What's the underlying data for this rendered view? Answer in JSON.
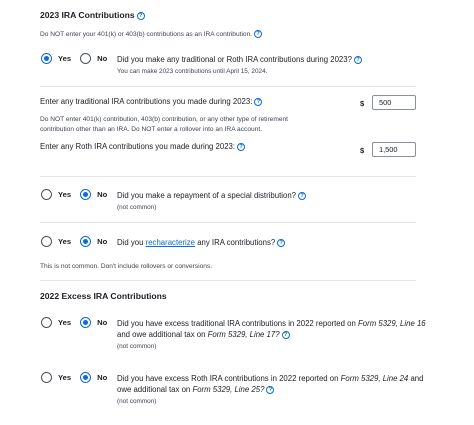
{
  "section1": {
    "heading": "2023 IRA Contributions",
    "note": "Do NOT enter your 401(k) or 403(b) contributions as an IRA contribution.",
    "q1": {
      "yes": "Yes",
      "no": "No",
      "text": "Did you make any traditional or Roth IRA contributions during 2023?",
      "sub": "You can make 2023 contributions until April 15, 2024.",
      "selected": "yes"
    },
    "traditional": {
      "label": "Enter any traditional IRA contributions you made during 2023:",
      "currency": "$",
      "value": "500"
    },
    "traditional_note_line1": "Do NOT enter 401(k) contribution, 403(b) contribution, or any other type of retirement",
    "traditional_note_line2": "contribution other than an IRA. Do NOT enter a rollover into an IRA account.",
    "roth": {
      "label": "Enter any Roth IRA contributions you made during 2023:",
      "currency": "$",
      "value": "1,500"
    },
    "q2": {
      "yes": "Yes",
      "no": "No",
      "text": "Did you make a repayment of a special distribution?",
      "sub": "(not common)",
      "selected": "no"
    },
    "q3": {
      "yes": "Yes",
      "no": "No",
      "text_before": "Did you",
      "link": "recharacterize",
      "text_after": "any IRA contributions?",
      "selected": "no"
    },
    "q3_note": "This is not common. Don't include rollovers or conversions."
  },
  "section2": {
    "heading": "2022 Excess IRA Contributions",
    "q4": {
      "yes": "Yes",
      "no": "No",
      "line1_before": "Did you have excess traditional IRA contributions in 2022 reported on",
      "line1_em": "Form 5329, Line 16",
      "line2_before": "and owe additional tax on",
      "line2_em": "Form 5329, Line 17",
      "line2_after": "?",
      "sub": "(not common)",
      "selected": "no"
    },
    "q5": {
      "yes": "Yes",
      "no": "No",
      "line1_before": "Did you have excess Roth IRA contributions in 2022 reported on",
      "line1_em": "Form 5329, Line 24",
      "line1_after": "and",
      "line2_before": "owe additional tax on",
      "line2_em": "Form 5329, Line 25",
      "line2_after": "?",
      "sub": "(not common)",
      "selected": "no"
    }
  },
  "icons": {
    "help": "help-circle-icon"
  },
  "colors": {
    "accent": "#0d6ad9",
    "text": "#1b1e24",
    "muted": "#3d4450",
    "divider": "#e4e6ea"
  }
}
